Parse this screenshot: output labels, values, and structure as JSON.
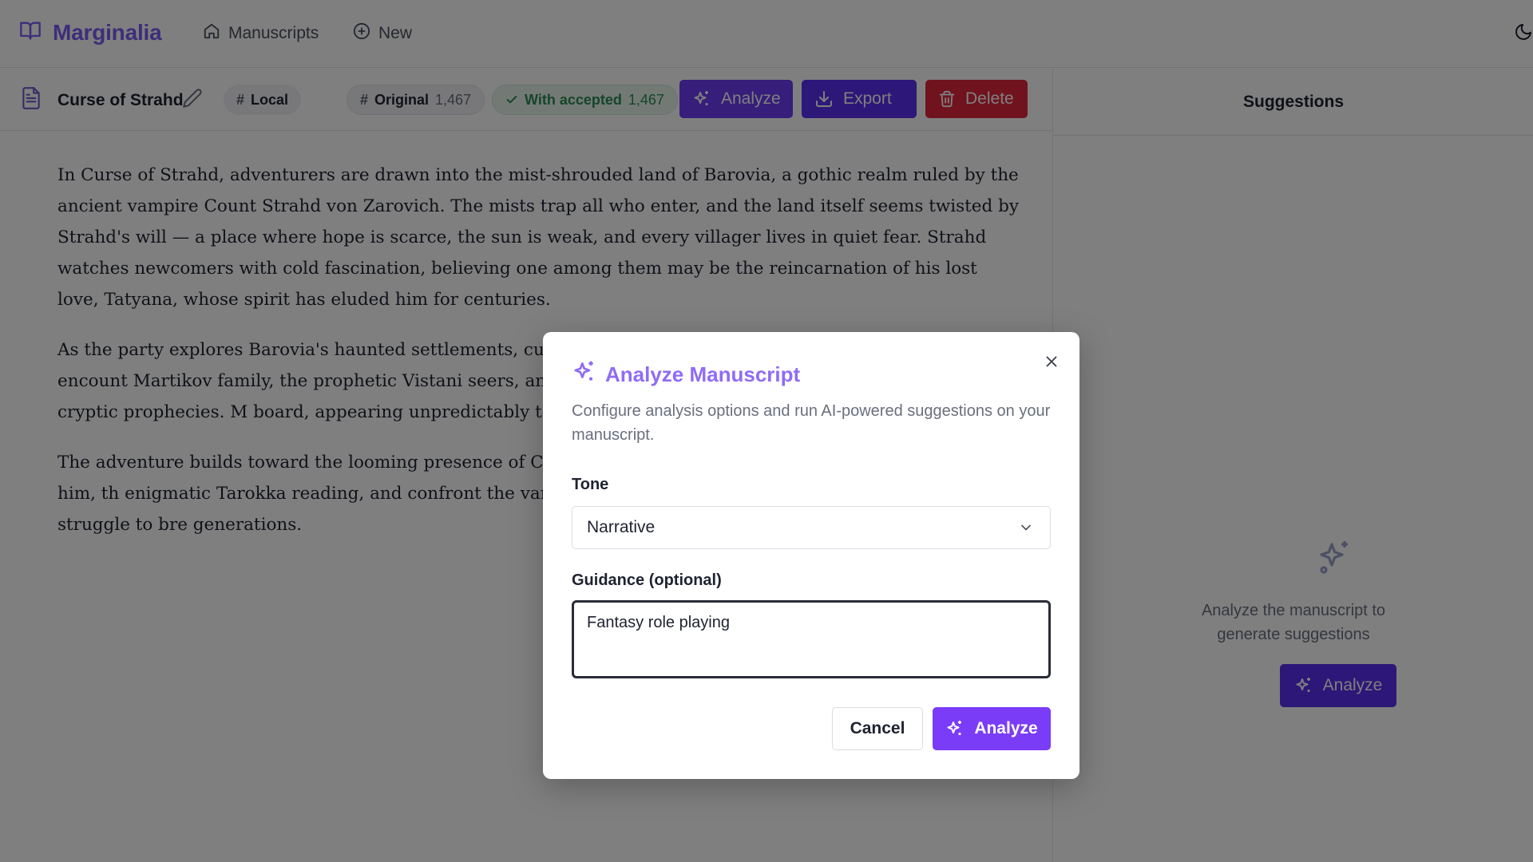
{
  "app": {
    "name": "Marginalia"
  },
  "nav": {
    "manuscripts": "Manuscripts",
    "new": "New"
  },
  "document": {
    "title": "Curse of Strahd",
    "location": "Local"
  },
  "counts": {
    "original_label": "Original",
    "original_value": "1,467",
    "accepted_label": "With accepted",
    "accepted_value": "1,467"
  },
  "toolbar": {
    "analyze": "Analyze",
    "export": "Export",
    "delete": "Delete"
  },
  "sidebar": {
    "title": "Suggestions",
    "empty_text": "Analyze the manuscript to generate suggestions",
    "analyze": "Analyze"
  },
  "content": {
    "p1": "In Curse of Strahd, adventurers are drawn into the mist-shrouded land of Barovia, a gothic realm ruled by the ancient vampire Count Strahd von Zarovich. The mists trap all who enter, and the land itself seems twisted by Strahd's will — a place where hope is scarce, the sun is weak, and every villager lives in quiet fear. Strahd watches newcomers with cold fascination, believing one among them may be the reincarnation of his lost love, Tatyana, whose spirit has eluded him for centuries.",
    "p2": "As the party explores Barovia's haunted settlements, curse tragic history that binds Strahd to the land. They encount Martikov family, the prophetic Vistani seers, and the belea fragments of guidance, warnings, or cryptic prophecies. M board, appearing unpredictably to test, tempt, or torment",
    "p3": "The adventure builds toward the looming presence of Cas and Strahd's own melancholy grandeur. To defeat him, th enigmatic Tarokka reading, and confront the vampire lor of tragic obsession, creeping dread, and the struggle to bre generations."
  },
  "dialog": {
    "title": "Analyze Manuscript",
    "description": "Configure analysis options and run AI-powered suggestions on your manuscript.",
    "tone_label": "Tone",
    "tone_value": "Narrative",
    "guidance_label": "Guidance (optional)",
    "guidance_value": "Fantasy role playing",
    "cancel": "Cancel",
    "analyze": "Analyze"
  },
  "colors": {
    "brand": "#7c5cf2",
    "primary": "#5a2ff0",
    "danger": "#e0263e",
    "success": "#2d8a52",
    "dialog_primary": "#7b3cf7"
  },
  "icons": {
    "logo": "book-open-icon",
    "home": "home-icon",
    "new": "plus-circle-icon",
    "theme": "moon-icon",
    "doc": "file-text-icon",
    "edit": "pencil-icon",
    "hash": "hash-icon",
    "check": "check-icon",
    "sparkles": "sparkles-icon",
    "download": "download-icon",
    "trash": "trash-icon",
    "close": "close-icon",
    "chevron": "chevron-down-icon"
  }
}
